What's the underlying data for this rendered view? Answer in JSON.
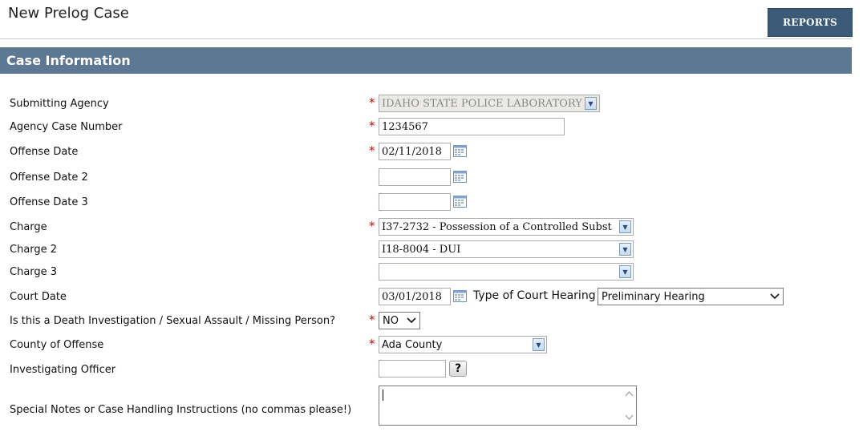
{
  "header": {
    "title": "New Prelog Case",
    "reports_label": "REPORTS"
  },
  "section": {
    "title": "Case Information"
  },
  "labels": {
    "submitting_agency": "Submitting Agency",
    "agency_case_number": "Agency Case Number",
    "offense_date": "Offense Date",
    "offense_date_2": "Offense Date 2",
    "offense_date_3": "Offense Date 3",
    "charge": "Charge",
    "charge_2": "Charge 2",
    "charge_3": "Charge 3",
    "court_date": "Court Date",
    "death_question": "Is this a Death Investigation / Sexual Assault / Missing Person?",
    "county": "County of Offense",
    "officer": "Investigating Officer",
    "notes": "Special Notes or Case Handling Instructions (no commas please!)",
    "hearing_type": "Type of Court Hearing"
  },
  "values": {
    "submitting_agency": "IDAHO STATE POLICE LABORATORY",
    "agency_case_number": "1234567",
    "offense_date": "02/11/2018",
    "offense_date_2": "",
    "offense_date_3": "",
    "charge": "I37-2732 - Possession of a Controlled Subst",
    "charge_2": "I18-8004 - DUI",
    "charge_3": "",
    "court_date": "03/01/2018",
    "hearing_type": "Preliminary Hearing",
    "death_answer": "NO",
    "county": "Ada County",
    "officer": "",
    "notes": ""
  },
  "required_marker": "*",
  "help_label": "?",
  "colors": {
    "section_bg": "#5d7893",
    "button_bg": "#3b5a78",
    "required": "#dd0000"
  }
}
